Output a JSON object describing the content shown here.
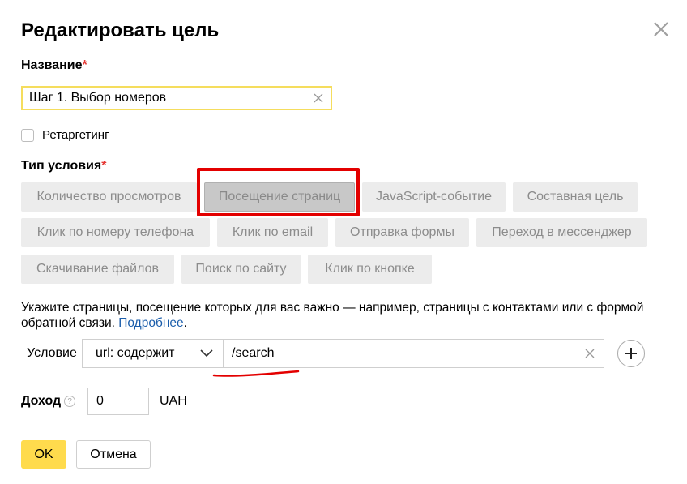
{
  "dialog": {
    "title": "Редактировать цель"
  },
  "name_field": {
    "label": "Название",
    "required_mark": "*",
    "value": "Шаг 1. Выбор номеров"
  },
  "retargeting": {
    "label": "Ретаргетинг",
    "checked": false
  },
  "condition_type": {
    "label": "Тип условия",
    "required_mark": "*",
    "options": [
      "Количество просмотров",
      "Посещение страниц",
      "JavaScript-событие",
      "Составная цель",
      "Клик по номеру телефона",
      "Клик по email",
      "Отправка формы",
      "Переход в мессенджер",
      "Скачивание файлов",
      "Поиск по сайту",
      "Клик по кнопке"
    ],
    "selected": "Посещение страниц"
  },
  "description": {
    "text": "Укажите страницы, посещение которых для вас важно — например, страницы с контактами или с формой обратной связи.",
    "link": "Подробнее",
    "end": "."
  },
  "condition": {
    "label": "Условие",
    "match_type": "url: содержит",
    "value": "/search"
  },
  "income": {
    "label": "Доход",
    "help_symbol": "?",
    "value": "0",
    "currency": "UAH"
  },
  "buttons": {
    "ok": "OK",
    "cancel": "Отмена"
  },
  "colors": {
    "highlight": "#e30000",
    "accent": "#ffdb4d",
    "link": "#1a5dab"
  },
  "icons": [
    "close-icon",
    "clear-icon",
    "chevron-down-icon",
    "plus-icon",
    "help-icon"
  ]
}
